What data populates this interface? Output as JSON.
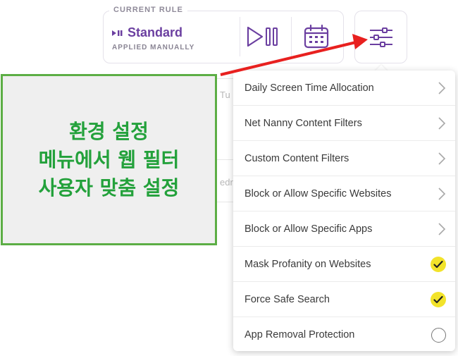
{
  "rule": {
    "caption": "CURRENT RULE",
    "name": "Standard",
    "subtitle": "APPLIED MANUALLY"
  },
  "background": {
    "fragment1": "Tu",
    "fragment2": "edr"
  },
  "menu": {
    "items": [
      {
        "label": "Daily Screen Time Allocation",
        "control": "chevron"
      },
      {
        "label": "Net Nanny Content Filters",
        "control": "chevron"
      },
      {
        "label": "Custom Content Filters",
        "control": "chevron"
      },
      {
        "label": "Block or Allow Specific Websites",
        "control": "chevron"
      },
      {
        "label": "Block or Allow Specific Apps",
        "control": "chevron"
      },
      {
        "label": "Mask Profanity on Websites",
        "control": "checked"
      },
      {
        "label": "Force Safe Search",
        "control": "checked"
      },
      {
        "label": "App Removal Protection",
        "control": "unchecked"
      }
    ]
  },
  "annotation": {
    "lines": [
      "환경 설정",
      "메뉴에서 웹 필터",
      "사용자 맞춤 설정"
    ]
  },
  "colors": {
    "accent_purple": "#6b3fa0",
    "check_yellow": "#f2e32a",
    "annotation_green": "#23a13b",
    "arrow_red": "#e8201f"
  },
  "icons": {
    "rule_mode": "play-pause-icon",
    "play_pause": "play-pause-icon",
    "calendar": "calendar-icon",
    "settings": "sliders-icon",
    "chevron": "chevron-right-icon",
    "check": "check-icon"
  }
}
